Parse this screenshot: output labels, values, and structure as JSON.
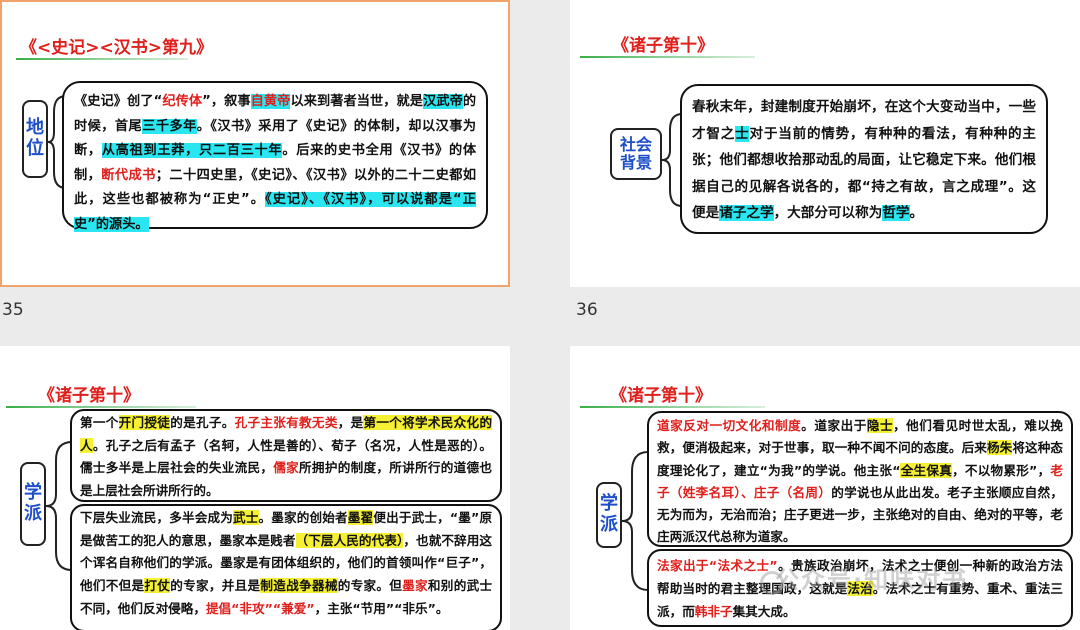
{
  "slides": [
    {
      "number": "35",
      "title": "《<史记><汉书>第九》",
      "side_label_lines": [
        "地",
        "位"
      ],
      "box_segments": [
        {
          "t": "《史记》创了“"
        },
        {
          "t": "纪传体",
          "s": "r"
        },
        {
          "t": "”，叙事"
        },
        {
          "t": "自黄帝",
          "s": "hcr"
        },
        {
          "t": "以来到著者当世，就是"
        },
        {
          "t": "汉武帝",
          "s": "hc"
        },
        {
          "t": "的时候，首尾"
        },
        {
          "t": "三千多年",
          "s": "hc"
        },
        {
          "t": "。《汉书》采用了《史记》的体制，却以汉事为断，"
        },
        {
          "t": "从高祖到王莽，只二百三十年",
          "s": "hc"
        },
        {
          "t": "。后来的史书全用《汉书》的体制，"
        },
        {
          "t": "断代成书",
          "s": "r"
        },
        {
          "t": "；二十四史里，《史记》、《汉书》以外的二十二史都如此，这些也都被称为“正史”。"
        },
        {
          "t": "《史记》、《汉书》，可以说都是“正史”的源头。",
          "s": "hc"
        }
      ]
    },
    {
      "number": "36",
      "title": "《诸子第十》",
      "side_label_lines": [
        "社会",
        "背景"
      ],
      "box_segments": [
        {
          "t": "春秋末年，封建制度开始崩坏，在这个大变动当中，一些才智之"
        },
        {
          "t": "士",
          "s": "hc"
        },
        {
          "t": "对于当前的情势，有种种的看法，有种种的主张；他们都想收拾那动乱的局面，让它稳定下来。他们根据自己的见解各说各的，都“持之有故，言之成理”。这便是"
        },
        {
          "t": "诸子之学",
          "s": "hc"
        },
        {
          "t": "，大部分可以称为"
        },
        {
          "t": "哲学",
          "s": "hc"
        },
        {
          "t": "。"
        }
      ]
    },
    {
      "number": "",
      "title": "《诸子第十》",
      "side_label_lines": [
        "学",
        "派"
      ],
      "box1_segments": [
        {
          "t": "第一个"
        },
        {
          "t": "开门授徒",
          "s": "hy"
        },
        {
          "t": "的是孔子。"
        },
        {
          "t": "孔子主张有教无类",
          "s": "r"
        },
        {
          "t": "，是"
        },
        {
          "t": "第一个将学术民众化的人",
          "s": "hy"
        },
        {
          "t": "。孔子之后有孟子（名轲，人性是善的）、荀子（名况，人性是恶的）。儒士多半是上层社会的失业流民，"
        },
        {
          "t": "儒",
          "s": "r"
        },
        {
          "t": "家",
          "s": "r"
        },
        {
          "t": "所拥护的制度，所讲所行的道德也是上层社会所讲所行的。"
        }
      ],
      "box2_segments": [
        {
          "t": "下层失业流民，多半会成为"
        },
        {
          "t": "武士",
          "s": "hy"
        },
        {
          "t": "。墨家的创始者"
        },
        {
          "t": "墨翟",
          "s": "hy"
        },
        {
          "t": "便出于武士，“墨”原是做苦工的犯人的意思，墨家本是贱者"
        },
        {
          "t": "（下层人民的代表）",
          "s": "hy"
        },
        {
          "t": "，也就不辞用这个诨名自称他们的学派。墨家是有团体组织的，他们的首领叫作“巨子”，他们不但是"
        },
        {
          "t": "打仗",
          "s": "hy"
        },
        {
          "t": "的专家，并且是"
        },
        {
          "t": "制造战争器械",
          "s": "hy"
        },
        {
          "t": "的专家。但"
        },
        {
          "t": "墨家",
          "s": "r"
        },
        {
          "t": "和别的武士不同，他们反对侵略，"
        },
        {
          "t": "提倡“非攻”“兼爱”",
          "s": "r"
        },
        {
          "t": "，主张“节用”“非乐”。"
        }
      ]
    },
    {
      "number": "",
      "title": "《诸子第十》",
      "side_label_lines": [
        "学",
        "派"
      ],
      "box1_segments": [
        {
          "t": "道家反对一切文化和制度",
          "s": "r"
        },
        {
          "t": "。道家出于"
        },
        {
          "t": "隐士",
          "s": "hy"
        },
        {
          "t": "，他们看见时世太乱，难以挽救，便消极起来，对于世事，取一种不闻不问的态度。后来"
        },
        {
          "t": "杨朱",
          "s": "hy"
        },
        {
          "t": "将这种态度理论化了，建立“为我”的学说。他主张“"
        },
        {
          "t": "全生保真",
          "s": "hy"
        },
        {
          "t": "，不以物累形”，"
        },
        {
          "t": "老子（姓李名耳）、庄子（名周）",
          "s": "r"
        },
        {
          "t": "的学说也从此出发。老子主张顺应自然，无为而为，无治而治；庄子更进一步，主张绝对的自由、绝对的平等，老庄两派汉代总称为道家。"
        }
      ],
      "box2_segments": [
        {
          "t": "法家出于“法术之士”",
          "s": "r"
        },
        {
          "t": "。贵族政治崩坏，法术之士便创一种新的政治方法帮助当时的君主整理国政，这就是"
        },
        {
          "t": "法治",
          "s": "hy"
        },
        {
          "t": "。法术之士有重势、重术、重法三派，而"
        },
        {
          "t": "韩非子",
          "s": "r"
        },
        {
          "t": "集其大成。"
        }
      ],
      "watermark": "公众号·知味对书"
    }
  ]
}
